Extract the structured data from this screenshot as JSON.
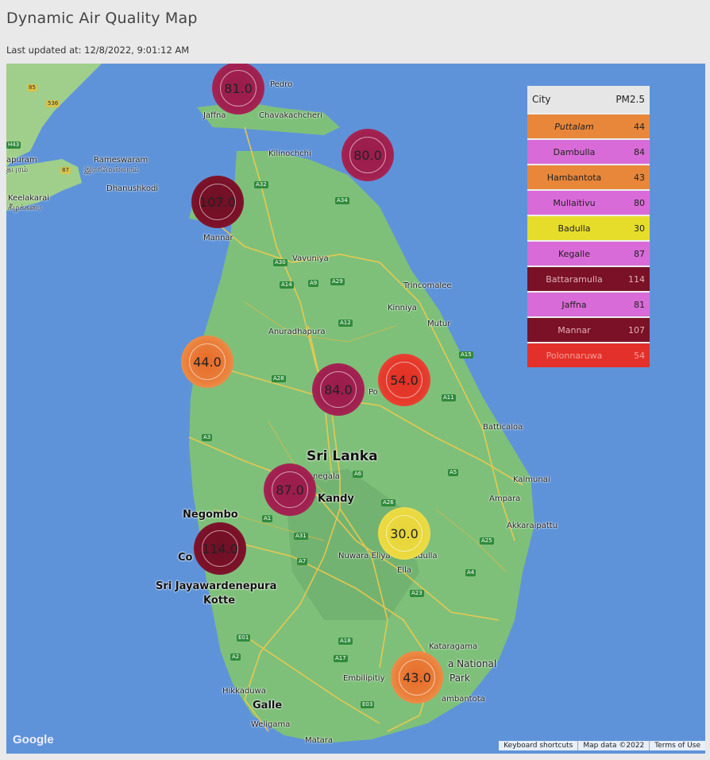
{
  "header": {
    "title": "Dynamic Air Quality Map",
    "last_updated": "Last updated at: 12/8/2022, 9:01:12 AM"
  },
  "legend": {
    "col_city": "City",
    "col_pm": "PM2.5",
    "rows": [
      {
        "city": "Puttalam",
        "value": "44",
        "color": "#e8873a"
      },
      {
        "city": "Dambulla",
        "value": "84",
        "color": "#d96bd8"
      },
      {
        "city": "Hambantota",
        "value": "43",
        "color": "#e8873a"
      },
      {
        "city": "Mullaitivu",
        "value": "80",
        "color": "#d96bd8"
      },
      {
        "city": "Badulla",
        "value": "30",
        "color": "#e6dd2a"
      },
      {
        "city": "Kegalle",
        "value": "87",
        "color": "#d96bd8"
      },
      {
        "city": "Battaramulla",
        "value": "114",
        "color": "#7a1126"
      },
      {
        "city": "Jaffna",
        "value": "81",
        "color": "#d96bd8"
      },
      {
        "city": "Mannar",
        "value": "107",
        "color": "#7a1126"
      },
      {
        "city": "Polonnaruwa",
        "value": "54",
        "color": "#e4302a"
      }
    ]
  },
  "markers": [
    {
      "label": "81.0",
      "cls": "m-unhealthy"
    },
    {
      "label": "80.0",
      "cls": "m-unhealthy"
    },
    {
      "label": "107.0",
      "cls": "m-veryunh"
    },
    {
      "label": "44.0",
      "cls": "m-usg"
    },
    {
      "label": "84.0",
      "cls": "m-unhealthy"
    },
    {
      "label": "54.0",
      "cls": "m-red"
    },
    {
      "label": "87.0",
      "cls": "m-unhealthy"
    },
    {
      "label": "30.0",
      "cls": "m-moderate"
    },
    {
      "label": "114.0",
      "cls": "m-veryunh"
    },
    {
      "label": "43.0",
      "cls": "m-usg"
    }
  ],
  "places": {
    "pedro": "Pedro",
    "jaffna": "Jaffna",
    "chavakachcheri": "Chavakachcheri",
    "kilinochchi": "Kilinochchi",
    "rameswaram": "Rameswaram",
    "rameswaram_ta": "இராமேஸ்வரம்",
    "dhanushkodi": "Dhanushkodi",
    "keelakarai": "Keelakarai",
    "keelakarai_ta": "கீழக்கரை",
    "puram": "apuram",
    "puram_ta": "தபுரம்",
    "mannar": "Mannar",
    "vavuniya": "Vavuniya",
    "trincomalee": "Trincomalee",
    "kinniya": "Kinniya",
    "mutur": "Mutur",
    "anuradhapura": "Anuradhapura",
    "batticaloa": "Batticaloa",
    "srilanka": "Sri Lanka",
    "kurunegala": "negala",
    "kandy": "Kandy",
    "kalmunai": "Kalmunai",
    "ampara": "Ampara",
    "akkaraipattu": "Akkaraipattu",
    "negombo": "Negombo",
    "colombo": "Co",
    "sjk": "Sri Jayawardenepura",
    "kotte": "Kotte",
    "nuwara": "Nuwara Eliya",
    "badulla": "adulla",
    "ella": "Ella",
    "kataragama": "Kataragama",
    "national": "a National",
    "park": "Park",
    "embilipitiya": "Embilipitiy",
    "hambantota": "ambantota",
    "hikkaduwa": "Hikkaduwa",
    "galle": "Galle",
    "weligama": "Weligama",
    "matara": "Matara",
    "po": "Po"
  },
  "roads": [
    "85",
    "536",
    "H43",
    "87",
    "A32",
    "A9",
    "A34",
    "A30",
    "A14",
    "A29",
    "A12",
    "A15",
    "A28",
    "A11",
    "A3",
    "A6",
    "A1",
    "A26",
    "A5",
    "A4",
    "A31",
    "A7",
    "A25",
    "A23",
    "A18",
    "A2",
    "A17",
    "E01",
    "E03"
  ],
  "footer": {
    "google": "Google",
    "keyboard": "Keyboard shortcuts",
    "mapdata": "Map data ©2022",
    "terms": "Terms of Use"
  },
  "colors": {
    "water": "#5f93d9",
    "land": "#7ec07a",
    "road": "#f2c94c"
  }
}
